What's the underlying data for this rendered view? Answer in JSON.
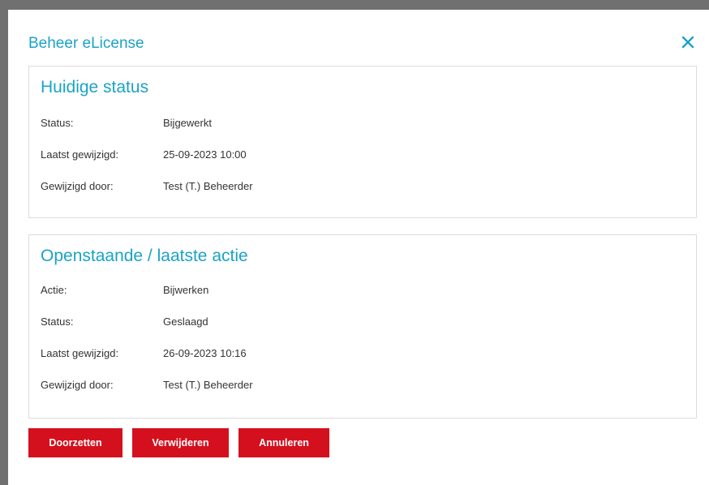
{
  "dialog": {
    "title": "Beheer eLicense",
    "close_icon": "close-icon"
  },
  "current_status": {
    "title": "Huidige status",
    "rows": [
      {
        "label": "Status:",
        "value": "Bijgewerkt"
      },
      {
        "label": "Laatst gewijzigd:",
        "value": "25-09-2023 10:00"
      },
      {
        "label": "Gewijzigd door:",
        "value": "Test (T.) Beheerder"
      }
    ]
  },
  "pending_action": {
    "title": "Openstaande / laatste actie",
    "rows": [
      {
        "label": "Actie:",
        "value": "Bijwerken"
      },
      {
        "label": "Status:",
        "value": "Geslaagd"
      },
      {
        "label": "Laatst gewijzigd:",
        "value": "26-09-2023 10:16"
      },
      {
        "label": "Gewijzigd door:",
        "value": "Test (T.) Beheerder"
      }
    ]
  },
  "actions": {
    "continue_label": "Doorzetten",
    "delete_label": "Verwijderen",
    "cancel_label": "Annuleren"
  },
  "colors": {
    "accent": "#1ba3c6",
    "button": "#d4101e"
  }
}
